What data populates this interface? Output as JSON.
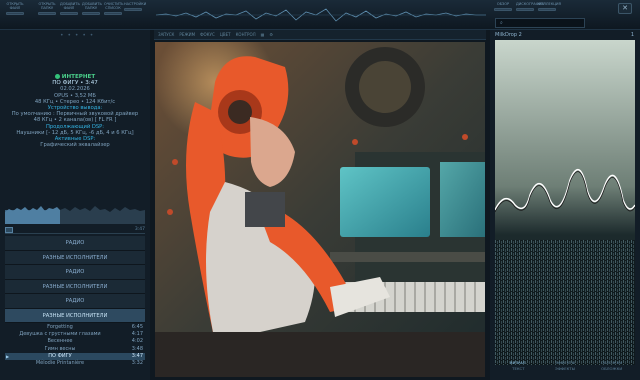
{
  "top_toolbar": {
    "left_buttons": [
      "ОТКРЫТЬ ФАЙЛ",
      "ОТКРЫТЬ ПАПКУ",
      "ДОБАВИТЬ ФАЙЛ",
      "ДОБАВИТЬ ПАПКУ",
      "ОЧИСТИТЬ СПИСОК",
      "",
      "НАСТРОЙКИ"
    ],
    "right_buttons": [
      "ОБЗОР",
      "ДИСКОГРАФИЯ",
      "КОЛЛЕКЦИЯ"
    ],
    "close_label": "✕"
  },
  "now_playing": {
    "source": "ИНТЕРНЕТ",
    "track": "ПО ФИГУ • 3:47",
    "date": "02.02.2026",
    "format": "OPUS • 3,52 МБ",
    "tech": "48 КГц • Стерео • 124 Кбит/с",
    "output_heading": "Устройство вывода:",
    "output_device": "По умолчанию : Первичный звуковой драйвер",
    "output_format": "48 КГц • 2 канала(ов) [ FL FR ]",
    "dsp_heading": "Продолжающий DSP:",
    "dsp_value": "Наушники [- 12 дБ, 5 КГц, -6 дБ, 4 и 6 КГц]",
    "active_dsp_heading": "Активные DSP:",
    "active_dsp_value": "Графический эквалайзер",
    "elapsed": "3:47"
  },
  "playlist_groups": [
    {
      "label": "РАДИО"
    },
    {
      "label": "РАЗНЫЕ ИСПОЛНИТЕЛИ"
    },
    {
      "label": "РАДИО"
    },
    {
      "label": "РАЗНЫЕ ИСПОЛНИТЕЛИ"
    },
    {
      "label": "РАДИО"
    },
    {
      "label": "РАЗНЫЕ ИСПОЛНИТЕЛИ"
    }
  ],
  "tracks": [
    {
      "title": "Forgetting",
      "duration": "6:45"
    },
    {
      "title": "Девушка с грустными глазами",
      "duration": "4:17"
    },
    {
      "title": "Весеннее",
      "duration": "4:02"
    },
    {
      "title": "Гимн весны",
      "duration": "3:48"
    },
    {
      "title": "ПО ФИГУ",
      "duration": "3:47"
    },
    {
      "title": "Mélodie Printanière",
      "duration": "3:32"
    }
  ],
  "center_toolbar": [
    "ЗАПУСК",
    "РЕЖИМ",
    "ФОКУС",
    "ЦВЕТ",
    "КОНТРОЛ"
  ],
  "visualizer": {
    "title": "MilkDrop 2",
    "preset_number": "1"
  },
  "right_tabs": [
    "ВИЗУАЛ.",
    "ЭФФЕКТЫ",
    "ОБЛОЖКИ",
    "ТЕКСТ",
    "ЭФФЕКТЫ",
    "ОБЛОЖКИ"
  ],
  "colors": {
    "accent": "#33b3e3",
    "source_green": "#34c27a",
    "panel": "#121d27"
  }
}
